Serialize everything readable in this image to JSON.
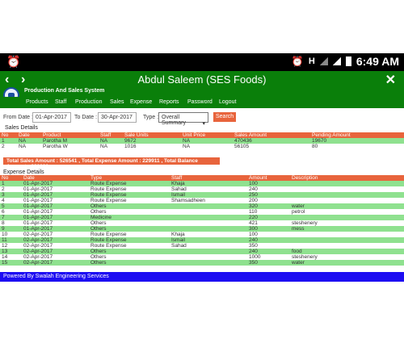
{
  "status_bar": {
    "network": "H",
    "time": "6:49 AM"
  },
  "app": {
    "title": "Abdul Saleem (SES Foods)",
    "subtitle": "Production And Sales System"
  },
  "menu": {
    "items": [
      "Products",
      "Staff",
      "Production",
      "Sales",
      "Expense",
      "Reports",
      "Password",
      "Logout"
    ]
  },
  "filters": {
    "from_label": "From Date :",
    "from_value": "01-Apr-2017",
    "to_label": "To Date :",
    "to_value": "30-Apr-2017",
    "type_label": "Type :",
    "type_value": "Overall Summary",
    "search_label": "Search"
  },
  "sales": {
    "title": "Sales Details",
    "headers": [
      "No",
      "Date",
      "Product",
      "Staff",
      "Sale Units",
      "Unit Price",
      "Sales Amount",
      "Pending Amount"
    ],
    "rows": [
      [
        "1",
        "NA",
        "Parotha M",
        "NA",
        "9672",
        "NA",
        "470436",
        "19670"
      ],
      [
        "2",
        "NA",
        "Parotha W",
        "NA",
        "1016",
        "NA",
        "56105",
        "80"
      ]
    ]
  },
  "totals": {
    "text": "Total Sales Amount : 526541 , Total Expense Amount : 229911 , Total Balance Amount : 296630"
  },
  "expense": {
    "title": "Expense Details",
    "headers": [
      "No",
      "Date",
      "Type",
      "Staff",
      "Amount",
      "Description"
    ],
    "rows": [
      [
        "1",
        "01-Apr-2017",
        "Route Expense",
        "Khaja",
        "100",
        ""
      ],
      [
        "2",
        "01-Apr-2017",
        "Route Expense",
        "Sahad",
        "240",
        ""
      ],
      [
        "3",
        "01-Apr-2017",
        "Route Expense",
        "Ismail",
        "250",
        ""
      ],
      [
        "4",
        "01-Apr-2017",
        "Route Expense",
        "Shamsadheen",
        "200",
        ""
      ],
      [
        "5",
        "01-Apr-2017",
        "Others",
        "",
        "320",
        "water"
      ],
      [
        "6",
        "01-Apr-2017",
        "Others",
        "",
        "110",
        "petrol"
      ],
      [
        "7",
        "01-Apr-2017",
        "Medicine",
        "",
        "220",
        ""
      ],
      [
        "8",
        "01-Apr-2017",
        "Others",
        "",
        "421",
        "steshenery"
      ],
      [
        "9",
        "01-Apr-2017",
        "Others",
        "",
        "300",
        "mess"
      ],
      [
        "10",
        "02-Apr-2017",
        "Route Expense",
        "Khaja",
        "100",
        ""
      ],
      [
        "11",
        "02-Apr-2017",
        "Route Expense",
        "Ismail",
        "240",
        ""
      ],
      [
        "12",
        "02-Apr-2017",
        "Route Expense",
        "Sahad",
        "350",
        ""
      ],
      [
        "13",
        "02-Apr-2017",
        "Others",
        "",
        "240",
        "food"
      ],
      [
        "14",
        "02-Apr-2017",
        "Others",
        "",
        "1000",
        "steshenery"
      ],
      [
        "15",
        "02-Apr-2017",
        "Others",
        "",
        "350",
        "water"
      ]
    ]
  },
  "footer": {
    "text": "Powered By Swalah Engineering Services"
  }
}
